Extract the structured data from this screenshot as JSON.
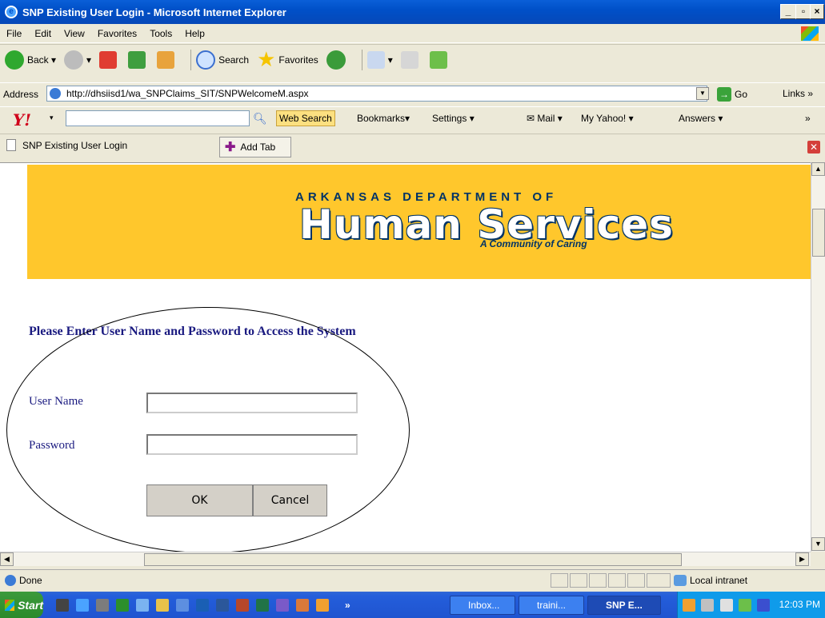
{
  "window": {
    "title": "SNP Existing User Login - Microsoft Internet Explorer"
  },
  "menu": [
    "File",
    "Edit",
    "View",
    "Favorites",
    "Tools",
    "Help"
  ],
  "toolbar": {
    "back": "Back",
    "search": "Search",
    "favorites": "Favorites"
  },
  "address": {
    "label": "Address",
    "url": "http://dhsiisd1/wa_SNPClaims_SIT/SNPWelcomeM.aspx",
    "go": "Go",
    "links": "Links"
  },
  "yahoo": {
    "logo": "Y!",
    "web_search": "Web Search",
    "bookmarks": "Bookmarks",
    "settings": "Settings",
    "mail": "Mail",
    "my_yahoo": "My Yahoo!",
    "answers": "Answers"
  },
  "tabs": {
    "current": "SNP Existing User Login",
    "add": "Add Tab"
  },
  "banner": {
    "top": "ARKANSAS DEPARTMENT OF",
    "main": "Human Services",
    "sub": "A Community of Caring"
  },
  "login": {
    "prompt": "Please Enter User Name and Password to Access the System",
    "username_label": "User Name",
    "password_label": "Password",
    "username_value": "",
    "password_value": "",
    "ok": "OK",
    "cancel": "Cancel"
  },
  "status": {
    "text": "Done",
    "zone": "Local intranet"
  },
  "taskbar": {
    "start": "Start",
    "items": [
      "Inbox...",
      "traini...",
      "SNP E..."
    ],
    "clock": "12:03 PM"
  }
}
